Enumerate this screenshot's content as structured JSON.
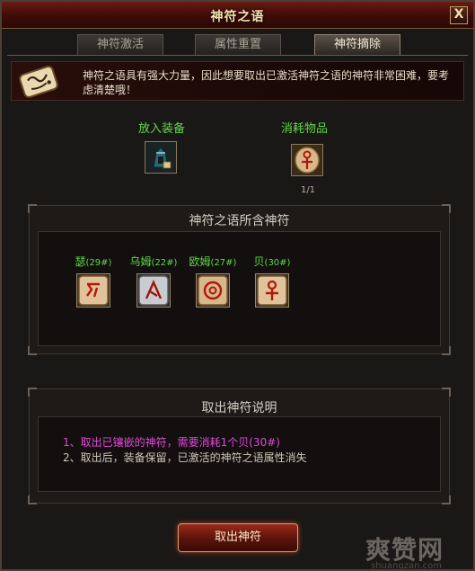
{
  "window": {
    "title": "神符之语",
    "close_label": "X"
  },
  "tabs": [
    {
      "label": "神符激活",
      "active": false
    },
    {
      "label": "属性重置",
      "active": false
    },
    {
      "label": "神符摘除",
      "active": true
    }
  ],
  "notice": {
    "text": "神符之语具有强大力量，因此想要取出已激活神符之语的神符非常困难，要考虑清楚哦！",
    "icon": "rune-scroll-icon"
  },
  "slots": {
    "equip_label": "放入装备",
    "equip_icon": "equipment-item-icon",
    "consume_label": "消耗物品",
    "consume_icon": "rune-item-icon",
    "consume_count": "1/1"
  },
  "runes_panel": {
    "title": "神符之语所含神符",
    "runes": [
      {
        "name": "瑟",
        "code": "(29#)",
        "icon": "rune-icon"
      },
      {
        "name": "乌姆",
        "code": "(22#)",
        "icon": "rune-icon"
      },
      {
        "name": "欧姆",
        "code": "(27#)",
        "icon": "rune-icon"
      },
      {
        "name": "贝",
        "code": "(30#)",
        "icon": "rune-icon"
      }
    ]
  },
  "desc_panel": {
    "title": "取出神符说明",
    "line1": "1、取出已镶嵌的神符，需要消耗1个贝(30#)",
    "line2": "2、取出后，装备保留，已激活的神符之语属性消失"
  },
  "action_button": {
    "label": "取出神符"
  },
  "watermark": {
    "main": "爽赞网",
    "url": "shuangzan.com"
  },
  "colors": {
    "green_label": "#5fd84a",
    "magenta_text": "#e04ad8",
    "title_bar": "#6a1a12"
  }
}
